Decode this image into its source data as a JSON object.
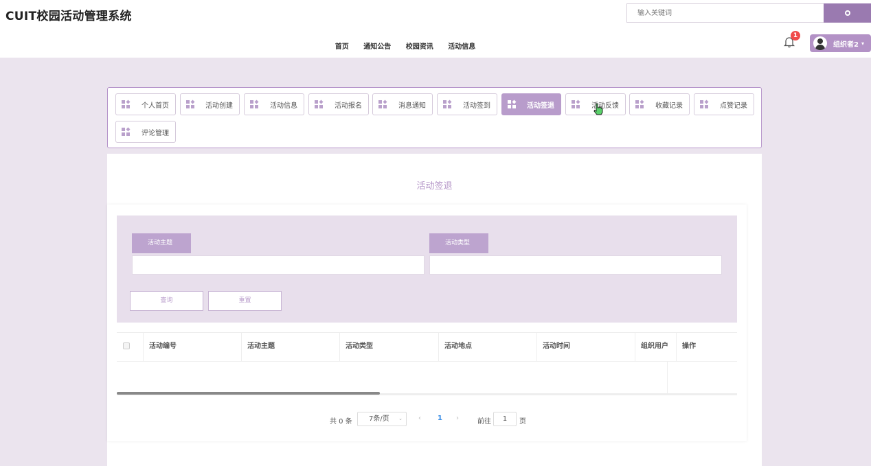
{
  "header": {
    "brand": "CUIT校园活动管理系统",
    "search_placeholder": "输入关键词",
    "nav": [
      "首页",
      "通知公告",
      "校园资讯",
      "活动信息"
    ],
    "notification_count": "1",
    "user_name": "组织者2"
  },
  "menu": {
    "items": [
      {
        "label": "个人首页"
      },
      {
        "label": "活动创建"
      },
      {
        "label": "活动信息"
      },
      {
        "label": "活动报名"
      },
      {
        "label": "消息通知"
      },
      {
        "label": "活动签到"
      },
      {
        "label": "活动签退",
        "active": true
      },
      {
        "label": "活动反馈"
      },
      {
        "label": "收藏记录"
      },
      {
        "label": "点赞记录"
      },
      {
        "label": "评论管理"
      }
    ]
  },
  "page": {
    "title": "活动签退",
    "filters": {
      "theme_label": "活动主题",
      "type_label": "活动类型",
      "query_button": "查询",
      "reset_button": "重置"
    },
    "table": {
      "columns": [
        "活动编号",
        "活动主题",
        "活动类型",
        "活动地点",
        "活动时间",
        "组织用户",
        "操作"
      ]
    },
    "pagination": {
      "total": "共 0 条",
      "page_size": "7条/页",
      "current_page": "1",
      "goto_label": "前往",
      "goto_value": "1",
      "page_unit": "页"
    }
  },
  "colors": {
    "accent": "#b89ccb",
    "search_button": "#9a7ab0",
    "background": "#ebe4ee",
    "badge": "#f04b4b",
    "active_page": "#3a8ee6"
  }
}
